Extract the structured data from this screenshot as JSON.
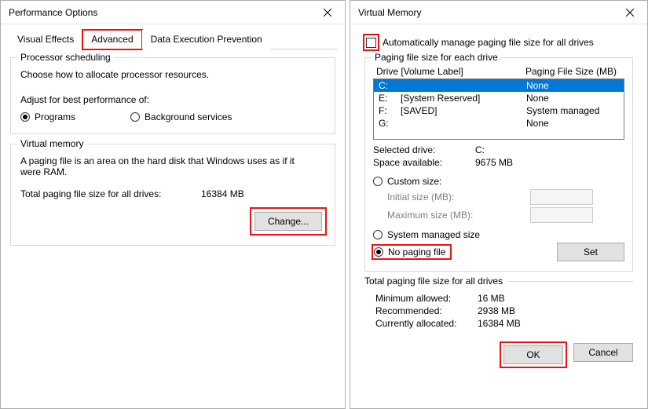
{
  "perf": {
    "title": "Performance Options",
    "tabs": {
      "visual": "Visual Effects",
      "advanced": "Advanced",
      "dep": "Data Execution Prevention"
    },
    "proc": {
      "legend": "Processor scheduling",
      "intro": "Choose how to allocate processor resources.",
      "adjust": "Adjust for best performance of:",
      "programs": "Programs",
      "background": "Background services"
    },
    "vm": {
      "legend": "Virtual memory",
      "desc": "A paging file is an area on the hard disk that Windows uses as if it were RAM.",
      "total_label": "Total paging file size for all drives:",
      "total_value": "16384 MB",
      "change": "Change..."
    }
  },
  "vm": {
    "title": "Virtual Memory",
    "auto": "Automatically manage paging file size for all drives",
    "drives_legend": "Paging file size for each drive",
    "head_drive": "Drive  [Volume Label]",
    "head_size": "Paging File Size (MB)",
    "rows": [
      {
        "d": "C:",
        "lbl": "",
        "size": "None"
      },
      {
        "d": "E:",
        "lbl": "[System Reserved]",
        "size": "None"
      },
      {
        "d": "F:",
        "lbl": "[SAVED]",
        "size": "System managed"
      },
      {
        "d": "G:",
        "lbl": "",
        "size": "None"
      }
    ],
    "selected_label": "Selected drive:",
    "selected_value": "C:",
    "space_label": "Space available:",
    "space_value": "9675 MB",
    "custom": "Custom size:",
    "initial": "Initial size (MB):",
    "maximum": "Maximum size (MB):",
    "managed": "System managed size",
    "none": "No paging file",
    "set": "Set",
    "totals_legend": "Total paging file size for all drives",
    "min_label": "Minimum allowed:",
    "min_value": "16 MB",
    "rec_label": "Recommended:",
    "rec_value": "2938 MB",
    "cur_label": "Currently allocated:",
    "cur_value": "16384 MB",
    "ok": "OK",
    "cancel": "Cancel"
  }
}
